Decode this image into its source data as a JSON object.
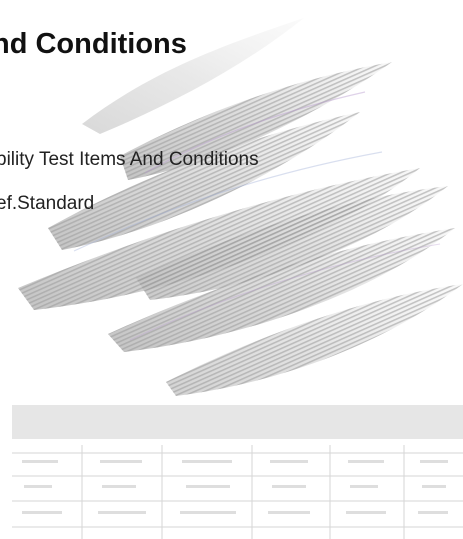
{
  "document": {
    "heading": "nd Conditions",
    "lines": [
      "bility Test Items And Conditions",
      "ef.Standard"
    ]
  },
  "colors": {
    "text": "#111111",
    "watermark": "#d8d8d8",
    "band": "#e6e6e6"
  }
}
